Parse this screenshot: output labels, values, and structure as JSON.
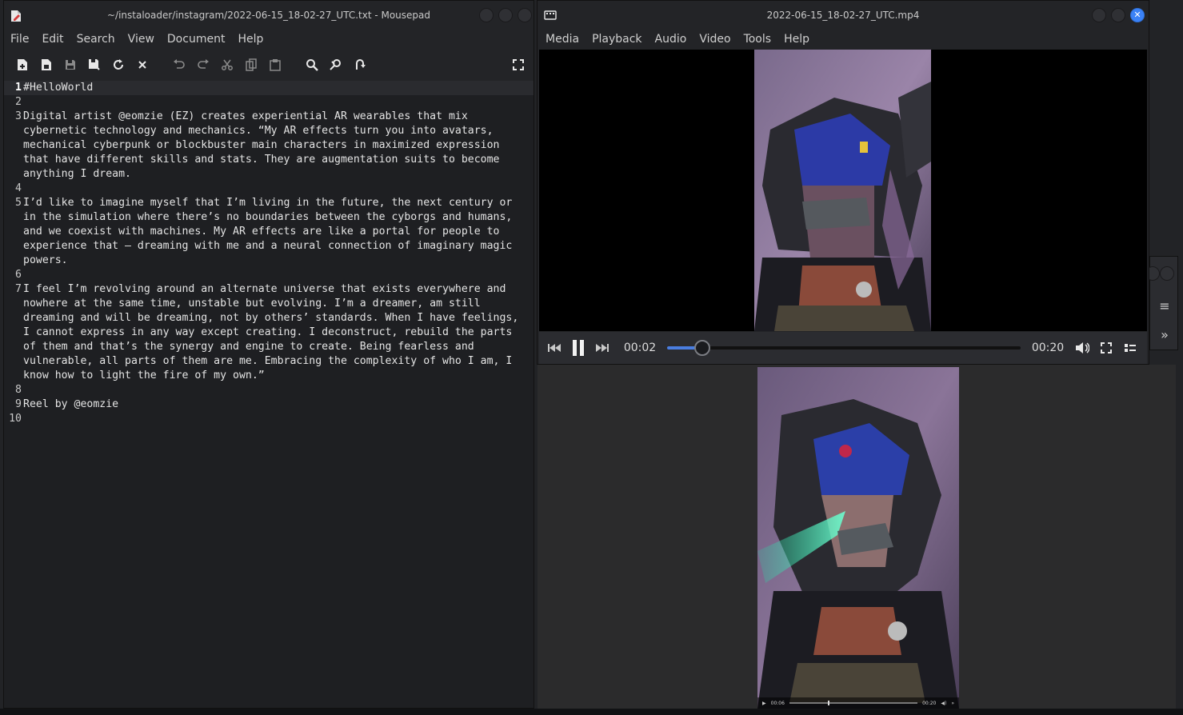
{
  "mousepad": {
    "title": "~/instaloader/instagram/2022-06-15_18-02-27_UTC.txt - Mousepad",
    "menu": [
      "File",
      "Edit",
      "Search",
      "View",
      "Document",
      "Help"
    ],
    "lines": [
      {
        "n": "1",
        "text": "#HelloWorld"
      },
      {
        "n": "2",
        "text": ""
      },
      {
        "n": "3",
        "text": "Digital artist @eomzie (EZ) creates experiential AR wearables that mix cybernetic technology and mechanics. “My AR effects turn you into avatars, mechanical cyberpunk or blockbuster main characters in maximized expression that have different skills and stats. They are augmentation suits to become anything I dream."
      },
      {
        "n": "4",
        "text": ""
      },
      {
        "n": "5",
        "text": "I’d like to imagine myself that I’m living in the future, the next century or in the simulation where there’s no boundaries between the cyborgs and humans, and we coexist with machines. My AR effects are like a portal for people to experience that — dreaming with me and a neural connection of imaginary magic powers."
      },
      {
        "n": "6",
        "text": ""
      },
      {
        "n": "7",
        "text": "I feel I’m revolving around an alternate universe that exists everywhere and nowhere at the same time, unstable but evolving. I’m a dreamer, am still dreaming and will be dreaming, not by others’ standards. When I have feelings, I cannot express in any way except creating. I deconstruct, rebuild the parts of them and that’s the synergy and engine to create. Being fearless and vulnerable, all parts of them are me. Embracing the complexity of who I am, I know how to light the fire of my own.”"
      },
      {
        "n": "8",
        "text": ""
      },
      {
        "n": "9",
        "text": "Reel by @eomzie"
      },
      {
        "n": "10",
        "text": ""
      }
    ]
  },
  "vlc": {
    "title": "2022-06-15_18-02-27_UTC.mp4",
    "menu": [
      "Media",
      "Playback",
      "Audio",
      "Video",
      "Tools",
      "Help"
    ],
    "elapsed": "00:02",
    "duration": "00:20",
    "progress": 0.1
  },
  "vlc2": {
    "elapsed": "00:06",
    "duration": "00:20",
    "progress": 0.3
  }
}
